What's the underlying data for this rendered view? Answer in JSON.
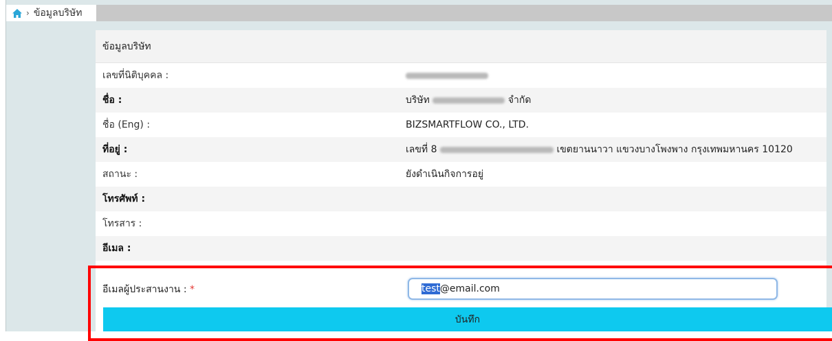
{
  "breadcrumb": {
    "current": "ข้อมูลบริษัท",
    "home_icon": "home-icon",
    "separator": "›"
  },
  "panel": {
    "title": "ข้อมูลบริษัท"
  },
  "fields": [
    {
      "label": "เลขที่นิติบุคคล :",
      "value": ""
    },
    {
      "label": "ชื่อ :",
      "value_prefix": "บริษัท",
      "value_suffix": "จำกัด"
    },
    {
      "label": "ชื่อ (Eng) :",
      "value": "BIZSMARTFLOW CO., LTD."
    },
    {
      "label": "ที่อยู่ :",
      "value_prefix": "เลขที่ 8",
      "value_suffix": "เขตยานนาวา แขวงบางโพงพาง กรุงเทพมหานคร 10120"
    },
    {
      "label": "สถานะ :",
      "value": "ยังดำเนินกิจการอยู่"
    },
    {
      "label": "โทรศัพท์ :",
      "value": ""
    },
    {
      "label": "โทรสาร :",
      "value": ""
    },
    {
      "label": "อีเมล :",
      "value": ""
    }
  ],
  "coordinator_email": {
    "label": "อีเมลผู้ประสานงาน :",
    "required_mark": "*",
    "value_selected": "test",
    "value_rest": "@email.com"
  },
  "save_button": {
    "label": "บันทึก"
  },
  "colors": {
    "accent": "#0ec9ef",
    "highlight_border": "#ff0000",
    "selection": "#2f6bd4",
    "home_icon": "#2aa6d8"
  }
}
